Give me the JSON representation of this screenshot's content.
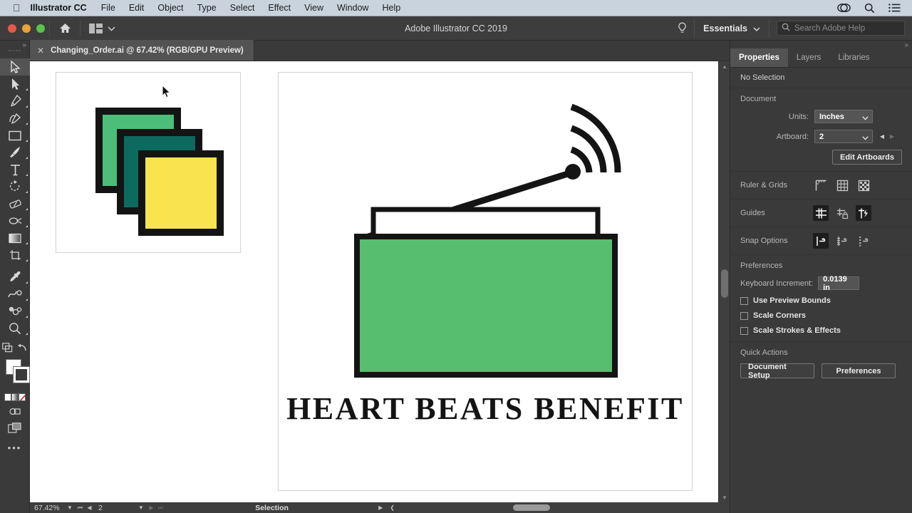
{
  "menubar": {
    "apple_icon": "apple-icon",
    "app_name": "Illustrator CC",
    "items": [
      "File",
      "Edit",
      "Object",
      "Type",
      "Select",
      "Effect",
      "View",
      "Window",
      "Help"
    ],
    "right_icons": [
      "creative-cloud-icon",
      "search-icon",
      "list-icon"
    ]
  },
  "titlebar": {
    "title": "Adobe Illustrator CC 2019",
    "home_icon": "home-icon",
    "layout_icon": "arrange-documents-icon",
    "bulb_icon": "lightbulb-icon",
    "workspace": "Essentials",
    "search_placeholder": "Search Adobe Help",
    "search_value": "",
    "search_icon": "search-icon"
  },
  "document_tab": {
    "close_icon": "close-icon",
    "label": "Changing_Order.ai @ 67.42% (RGB/GPU Preview)"
  },
  "tools": {
    "collapse_icon": "chevron-double-right-icon",
    "items": [
      {
        "name": "selection-tool",
        "selected": true,
        "flyout": false
      },
      {
        "name": "direct-selection-tool",
        "selected": false,
        "flyout": true
      },
      {
        "name": "pen-tool",
        "selected": false,
        "flyout": true
      },
      {
        "name": "curvature-tool",
        "selected": false,
        "flyout": true
      },
      {
        "name": "rectangle-tool",
        "selected": false,
        "flyout": true
      },
      {
        "name": "paintbrush-tool",
        "selected": false,
        "flyout": true
      },
      {
        "name": "type-tool",
        "selected": false,
        "flyout": true
      },
      {
        "name": "rotate-tool",
        "selected": false,
        "flyout": true
      },
      {
        "name": "eraser-tool",
        "selected": false,
        "flyout": true
      },
      {
        "name": "width-tool",
        "selected": false,
        "flyout": true
      },
      {
        "name": "gradient-tool",
        "selected": false,
        "flyout": true
      },
      {
        "name": "artboard-tool",
        "selected": false,
        "flyout": true
      },
      {
        "name": "eyedropper-tool",
        "selected": false,
        "flyout": true
      },
      {
        "name": "blend-tool",
        "selected": false,
        "flyout": true
      },
      {
        "name": "symbol-sprayer-tool",
        "selected": false,
        "flyout": true
      },
      {
        "name": "zoom-tool",
        "selected": false,
        "flyout": true
      }
    ],
    "fill_color": "#ffffff",
    "stroke_color": "#000000",
    "more_icon": "more-tools-icon"
  },
  "canvas": {
    "thumbnail_artboard": {
      "squares": [
        {
          "name": "green-square",
          "fill": "#4CBE7A"
        },
        {
          "name": "teal-square",
          "fill": "#0C6B5E"
        },
        {
          "name": "yellow-square",
          "fill": "#F8E44E"
        }
      ]
    },
    "main_artboard": {
      "artwork_name": "radio-illustration",
      "radio_body_color": "#56BE6E",
      "stroke_color": "#141414",
      "caption": "HEART BEATS BENEFIT"
    },
    "cursor": "arrow-cursor"
  },
  "statusbar": {
    "zoom_level": "67.42%",
    "artboard_number": "2",
    "tool_status": "Selection",
    "first_icon": "first-artboard-icon",
    "prev_icon": "previous-artboard-icon",
    "next_icon": "next-artboard-icon",
    "last_icon": "last-artboard-icon"
  },
  "panel": {
    "collapse_icon": "chevron-double-right-icon",
    "tabs": [
      {
        "label": "Properties",
        "active": true
      },
      {
        "label": "Layers",
        "active": false
      },
      {
        "label": "Libraries",
        "active": false
      }
    ],
    "selection_status": "No Selection",
    "document": {
      "title": "Document",
      "units_label": "Units:",
      "units_value": "Inches",
      "artboard_label": "Artboard:",
      "artboard_value": "2",
      "prev_icon": "previous-artboard-icon",
      "next_icon": "next-artboard-icon",
      "edit_artboards_label": "Edit Artboards"
    },
    "ruler_grids": {
      "label": "Ruler & Grids",
      "buttons": [
        {
          "name": "show-rulers-icon",
          "active": false
        },
        {
          "name": "show-grid-icon",
          "active": false
        },
        {
          "name": "show-transparency-grid-icon",
          "active": false
        }
      ]
    },
    "guides": {
      "label": "Guides",
      "buttons": [
        {
          "name": "show-guides-icon",
          "active": true
        },
        {
          "name": "lock-guides-icon",
          "active": false
        },
        {
          "name": "smart-guides-icon",
          "active": true
        }
      ]
    },
    "snap_options": {
      "label": "Snap Options",
      "buttons": [
        {
          "name": "snap-to-point-icon",
          "active": true
        },
        {
          "name": "snap-to-grid-icon",
          "active": false
        },
        {
          "name": "snap-to-pixel-icon",
          "active": false
        }
      ]
    },
    "preferences": {
      "title": "Preferences",
      "keyboard_increment_label": "Keyboard Increment:",
      "keyboard_increment_value": "0.0139 in",
      "checkboxes": [
        {
          "label": "Use Preview Bounds",
          "checked": false
        },
        {
          "label": "Scale Corners",
          "checked": false
        },
        {
          "label": "Scale Strokes & Effects",
          "checked": false
        }
      ]
    },
    "quick_actions": {
      "title": "Quick Actions",
      "buttons": [
        "Document Setup",
        "Preferences"
      ]
    }
  }
}
